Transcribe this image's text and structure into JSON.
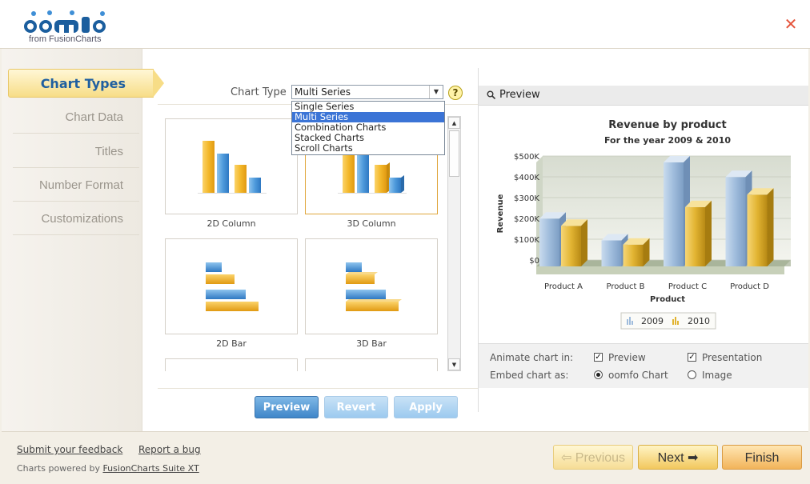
{
  "header": {
    "logo_text": "from FusionCharts",
    "close_label": "✕"
  },
  "sidebar": {
    "items": [
      {
        "label": "Chart Types",
        "active": true
      },
      {
        "label": "Chart Data"
      },
      {
        "label": "Titles"
      },
      {
        "label": "Number Format"
      },
      {
        "label": "Customizations"
      }
    ]
  },
  "chart_type": {
    "label": "Chart Type",
    "selected": "Multi Series",
    "options": [
      "Single Series",
      "Multi Series",
      "Combination Charts",
      "Stacked Charts",
      "Scroll Charts"
    ],
    "help": "?"
  },
  "gallery": {
    "items": [
      {
        "label": "2D Column"
      },
      {
        "label": "3D Column",
        "selected": true
      },
      {
        "label": "2D Bar"
      },
      {
        "label": "3D Bar"
      }
    ]
  },
  "actions": {
    "preview": "Preview",
    "revert": "Revert",
    "apply": "Apply"
  },
  "preview": {
    "title": "Preview",
    "options": {
      "animate_label": "Animate chart in:",
      "animate_preview": "Preview",
      "animate_presentation": "Presentation",
      "embed_label": "Embed chart as:",
      "embed_oomfo": "oomfo Chart",
      "embed_image": "Image"
    }
  },
  "chart_data": {
    "type": "bar",
    "title": "Revenue by product",
    "subtitle": "For the year 2009 & 2010",
    "xlabel": "Product",
    "ylabel": "Revenue",
    "ylim": [
      0,
      500
    ],
    "yticks": [
      "$0",
      "$100K",
      "$200K",
      "$300K",
      "$400K",
      "$500K"
    ],
    "categories": [
      "Product A",
      "Product B",
      "Product C",
      "Product D"
    ],
    "series": [
      {
        "name": "2009",
        "values": [
          230,
          125,
          500,
          430
        ],
        "color": "#9fbcdc"
      },
      {
        "name": "2010",
        "values": [
          195,
          105,
          285,
          345
        ],
        "color": "#e2b432"
      }
    ],
    "legend": "bottom"
  },
  "footer": {
    "feedback": "Submit your feedback",
    "bug": "Report a bug",
    "powered_prefix": "Charts powered by ",
    "powered_link": "FusionCharts Suite XT",
    "previous": "⇦ Previous",
    "next": "Next ➡",
    "finish": "Finish"
  }
}
